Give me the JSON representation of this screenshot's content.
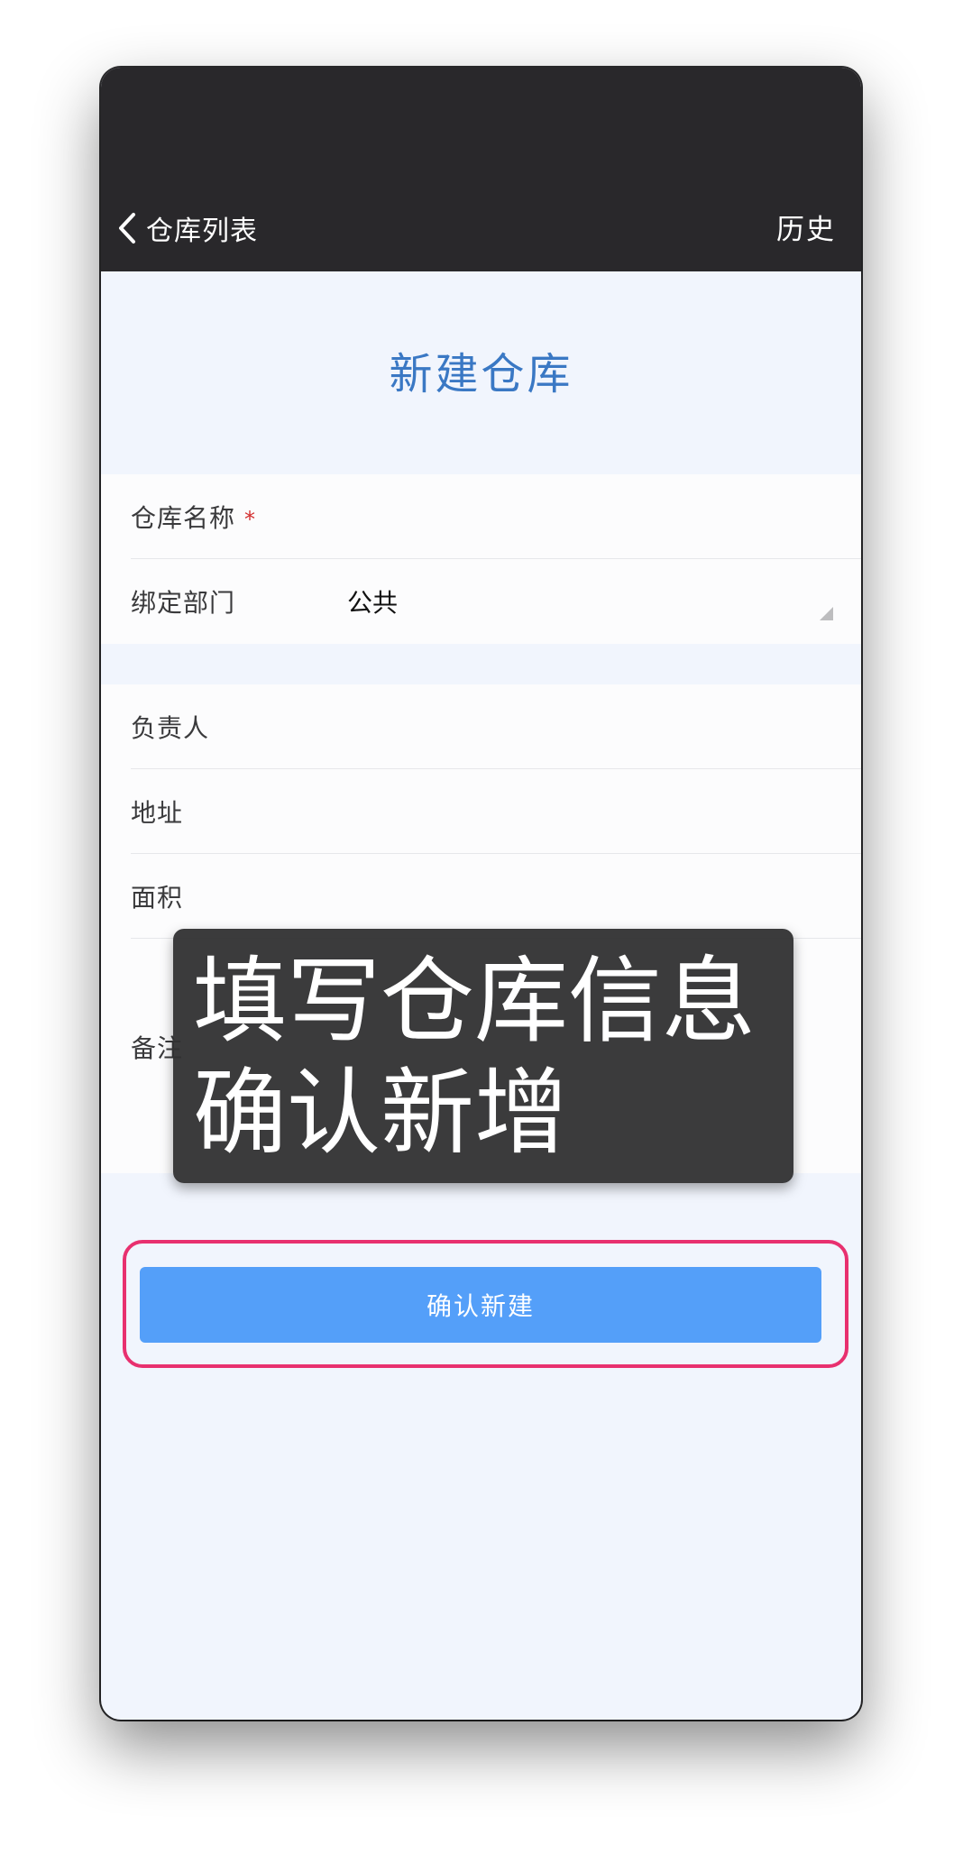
{
  "nav": {
    "back_label": "仓库列表",
    "history_label": "历史"
  },
  "page": {
    "title": "新建仓库"
  },
  "form": {
    "name_label": "仓库名称",
    "required_mark": "*",
    "department_label": "绑定部门",
    "department_value": "公共",
    "manager_label": "负责人",
    "address_label": "地址",
    "area_label": "面积",
    "remark_label": "备注"
  },
  "actions": {
    "confirm_label": "确认新建"
  },
  "overlay": {
    "line1": "填写仓库信息",
    "line2": "确认新增"
  },
  "colors": {
    "topbar": "#29282b",
    "title": "#3a78c4",
    "button": "#549ff9",
    "highlight": "#e8306f",
    "required": "#d32f2f"
  }
}
